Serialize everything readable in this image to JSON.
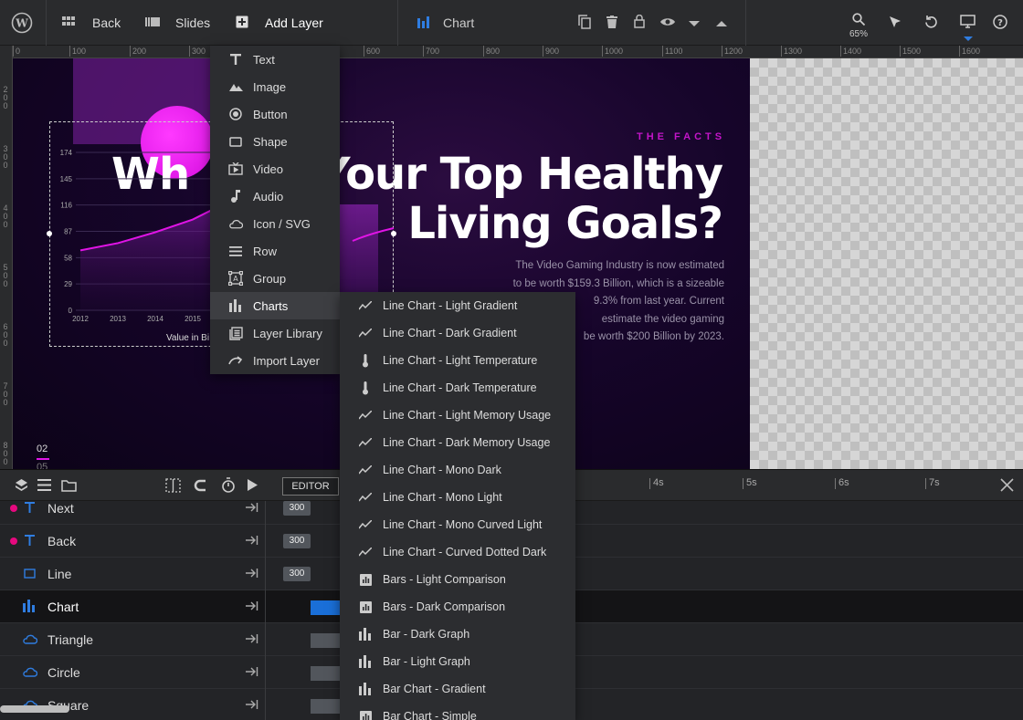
{
  "topbar": {
    "back_label": "Back",
    "slides_label": "Slides",
    "add_layer_label": "Add Layer",
    "chart_label": "Chart",
    "zoom": "65%"
  },
  "ruler": {
    "top_ticks": [
      "0",
      "100",
      "200",
      "300",
      "600",
      "700",
      "800",
      "900",
      "1000",
      "1100",
      "1200",
      "1300",
      "1400",
      "1500",
      "1600"
    ],
    "left_ticks": [
      "2 0 0",
      "3 0 0",
      "4 0 0",
      "5 0 0",
      "6 0 0",
      "7 0 0",
      "8 0 0"
    ]
  },
  "canvas": {
    "facts_label": "THE FACTS",
    "headline_left": "Wh",
    "headline_line1": "Your Top Healthy",
    "headline_line2": "Living Goals?",
    "body_copy_lines": [
      "The Video Gaming Industry is now estimated",
      "to be worth $159.3 Billion, which is a sizeable",
      "9.3% from last year. Current",
      "estimate the video gaming",
      "be worth $200 Billion by 2023."
    ],
    "layer_num_a": "02",
    "layer_num_b": "05"
  },
  "chart_data": {
    "type": "area",
    "x": [
      "2012",
      "2013",
      "2014",
      "2015"
    ],
    "series": [
      {
        "values": [
          66,
          74,
          86,
          100
        ]
      }
    ],
    "y_ticks": [
      "174",
      "145",
      "116",
      "87",
      "58",
      "29",
      "0"
    ],
    "xlabel": "Value in Bi",
    "ylim": [
      0,
      174
    ]
  },
  "add_layer_menu": [
    {
      "label": "Text",
      "icon": "text-icon"
    },
    {
      "label": "Image",
      "icon": "image-icon"
    },
    {
      "label": "Button",
      "icon": "button-icon"
    },
    {
      "label": "Shape",
      "icon": "shape-icon"
    },
    {
      "label": "Video",
      "icon": "video-icon"
    },
    {
      "label": "Audio",
      "icon": "audio-icon"
    },
    {
      "label": "Icon / SVG",
      "icon": "cloud-icon"
    },
    {
      "label": "Row",
      "icon": "row-icon"
    },
    {
      "label": "Group",
      "icon": "group-icon"
    },
    {
      "label": "Charts",
      "icon": "bar-chart-icon"
    },
    {
      "label": "Layer Library",
      "icon": "library-icon"
    },
    {
      "label": "Import Layer",
      "icon": "import-icon"
    }
  ],
  "charts_submenu": [
    {
      "label": "Line Chart - Light Gradient",
      "icon": "line-chart-icon"
    },
    {
      "label": "Line Chart - Dark Gradient",
      "icon": "line-chart-icon"
    },
    {
      "label": "Line Chart - Light Temperature",
      "icon": "thermometer-icon"
    },
    {
      "label": "Line Chart - Dark Temperature",
      "icon": "thermometer-icon"
    },
    {
      "label": "Line Chart - Light Memory Usage",
      "icon": "line-chart-icon"
    },
    {
      "label": "Line Chart - Dark Memory Usage",
      "icon": "line-chart-icon"
    },
    {
      "label": "Line Chart - Mono Dark",
      "icon": "line-chart-icon"
    },
    {
      "label": "Line Chart - Mono Light",
      "icon": "line-chart-icon"
    },
    {
      "label": "Line Chart - Mono Curved Light",
      "icon": "line-chart-icon"
    },
    {
      "label": "Line Chart - Curved Dotted Dark",
      "icon": "line-chart-icon"
    },
    {
      "label": "Bars - Light Comparison",
      "icon": "bar-chart-box-icon"
    },
    {
      "label": "Bars - Dark Comparison",
      "icon": "bar-chart-box-icon"
    },
    {
      "label": "Bar - Dark Graph",
      "icon": "bar-chart-icon"
    },
    {
      "label": "Bar - Light Graph",
      "icon": "bar-chart-icon"
    },
    {
      "label": "Bar Chart - Gradient",
      "icon": "bar-chart-icon"
    },
    {
      "label": "Bar Chart - Simple",
      "icon": "bar-chart-box-icon"
    }
  ],
  "timeline": {
    "editor_label": "EDITOR",
    "ticks": [
      "4s",
      "5s",
      "6s",
      "7s"
    ],
    "layers": [
      {
        "name": "Next",
        "icon": "text-icon",
        "badge": "300",
        "dot": true
      },
      {
        "name": "Back",
        "icon": "text-icon",
        "badge": "300",
        "dot": true
      },
      {
        "name": "Line",
        "icon": "rectangle-icon",
        "badge": "300",
        "dot": false
      },
      {
        "name": "Chart",
        "icon": "bar-chart-icon",
        "badge": "",
        "dot": false,
        "selected": true
      },
      {
        "name": "Triangle",
        "icon": "cloud-icon",
        "badge": "",
        "dot": false
      },
      {
        "name": "Circle",
        "icon": "cloud-icon",
        "badge": "",
        "dot": false
      },
      {
        "name": "Square",
        "icon": "cloud-icon",
        "badge": "",
        "dot": false
      }
    ]
  },
  "colors": {
    "accent": "#1a6fd8",
    "magenta": "#e014e6",
    "dot": "#e6097f"
  }
}
